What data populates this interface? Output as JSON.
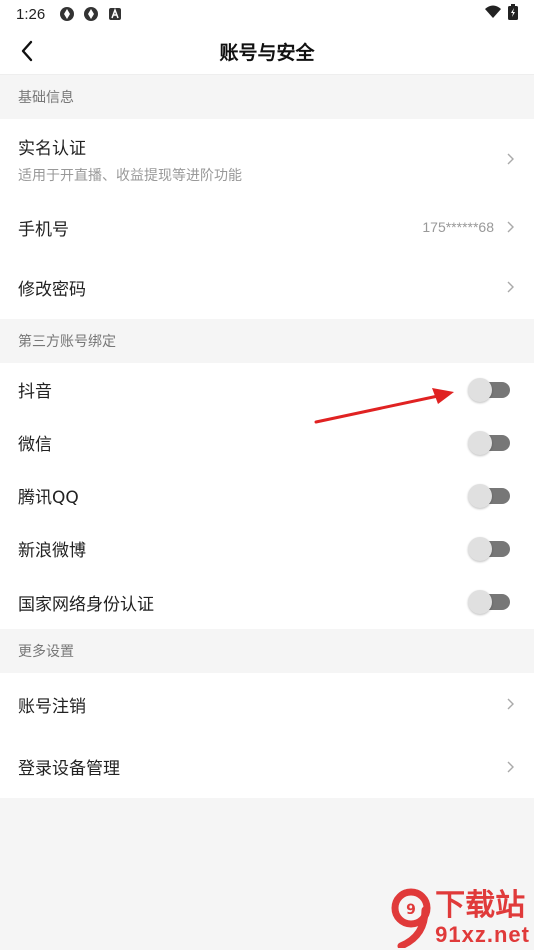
{
  "status_bar": {
    "time": "1:26",
    "icons": [
      "app-icon-1",
      "app-icon-2",
      "a-badge-icon"
    ],
    "right_icons": [
      "wifi-icon",
      "battery-icon"
    ]
  },
  "nav": {
    "title": "账号与安全",
    "back_icon": "chevron-left-icon"
  },
  "sections": {
    "basic": {
      "header": "基础信息",
      "realname": {
        "label": "实名认证",
        "sub": "适用于开直播、收益提现等进阶功能"
      },
      "phone": {
        "label": "手机号",
        "value": "175******68"
      },
      "password": {
        "label": "修改密码"
      }
    },
    "third_party": {
      "header": "第三方账号绑定",
      "items": [
        {
          "label": "抖音",
          "on": false
        },
        {
          "label": "微信",
          "on": false
        },
        {
          "label": "腾讯QQ",
          "on": false
        },
        {
          "label": "新浪微博",
          "on": false
        },
        {
          "label": "国家网络身份认证",
          "on": false
        }
      ]
    },
    "more": {
      "header": "更多设置",
      "cancel": {
        "label": "账号注销"
      },
      "devices": {
        "label": "登录设备管理"
      }
    }
  },
  "watermark": {
    "logo": "9",
    "cn": "下载站",
    "en": "91xz.net"
  },
  "colors": {
    "accent_red": "#e03a3a",
    "toggle_off_track": "#777777",
    "toggle_off_knob": "#e0e0e0"
  }
}
